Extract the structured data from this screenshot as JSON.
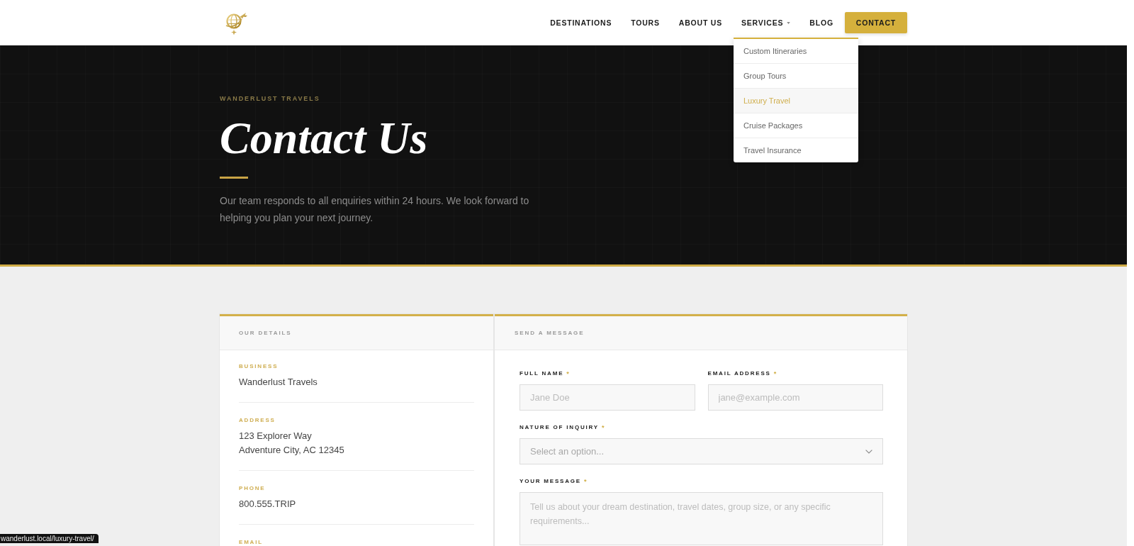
{
  "header": {
    "nav": [
      {
        "kind": "link",
        "label": "DESTINATIONS"
      },
      {
        "kind": "link",
        "label": "TOURS"
      },
      {
        "kind": "link",
        "label": "ABOUT US"
      },
      {
        "kind": "dropdown",
        "label": "SERVICES",
        "menu": {
          "expanded": true,
          "items": [
            {
              "label": "Custom Itineraries",
              "selected": false
            },
            {
              "label": "Group Tours",
              "selected": false
            },
            {
              "label": "Luxury Travel",
              "selected": true
            },
            {
              "label": "Cruise Packages",
              "selected": false
            },
            {
              "label": "Travel Insurance",
              "selected": false
            }
          ]
        }
      },
      {
        "kind": "link",
        "label": "BLOG"
      },
      {
        "kind": "button",
        "label": "CONTACT"
      }
    ]
  },
  "hero": {
    "eyebrow": "WANDERLUST TRAVELS",
    "title": "Contact Us",
    "intro": "Our team responds to all enquiries within 24 hours. We look forward to helping you plan your next journey."
  },
  "details_card": {
    "heading": "OUR DETAILS",
    "items": [
      {
        "label": "BUSINESS",
        "lines": [
          "Wanderlust Travels"
        ]
      },
      {
        "label": "ADDRESS",
        "lines": [
          "123 Explorer Way",
          "Adventure City, AC 12345"
        ]
      },
      {
        "label": "PHONE",
        "lines": [
          "800.555.TRIP"
        ]
      },
      {
        "label": "EMAIL"
      }
    ]
  },
  "message_form": {
    "heading": "SEND A MESSAGE",
    "fields": [
      {
        "kind": "text",
        "label": "FULL NAME",
        "required_mark": "*",
        "placeholder": "Jane Doe"
      },
      {
        "kind": "text",
        "label": "EMAIL ADDRESS",
        "required_mark": "*",
        "placeholder": "jane@example.com"
      },
      {
        "kind": "select",
        "label": "NATURE OF INQUIRY",
        "required_mark": "*",
        "placeholder": "Select an option..."
      },
      {
        "kind": "textarea",
        "label": "YOUR MESSAGE",
        "required_mark": "*",
        "placeholder": "Tell us about your dream destination, travel dates, group size, or any specific requirements..."
      }
    ]
  },
  "status_url": "wanderlust.local/luxury-travel/"
}
